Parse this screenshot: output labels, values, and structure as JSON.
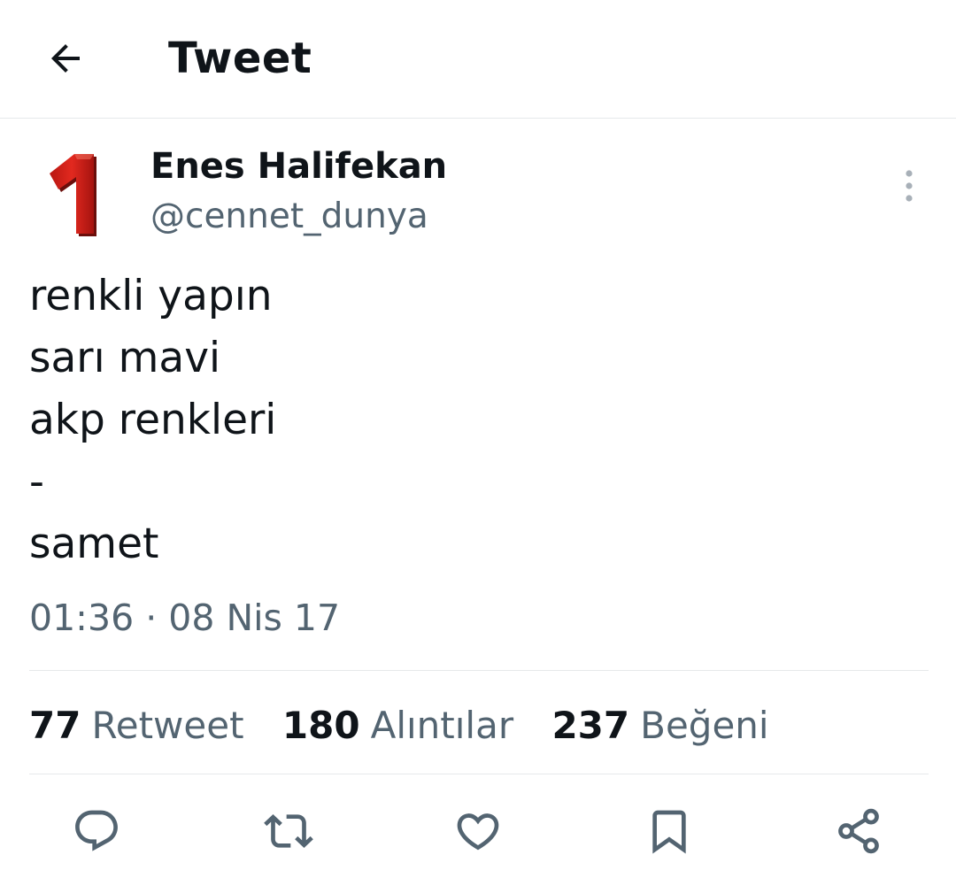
{
  "header": {
    "title": "Tweet",
    "back_icon": "back-arrow-icon"
  },
  "author": {
    "display_name": "Enes Halifekan",
    "handle": "@cennet_dunya",
    "avatar_text": "1",
    "avatar_color": "#d0231f"
  },
  "tweet": {
    "lines": [
      "renkli yapın",
      "sarı mavi",
      "akp renkleri",
      "-",
      "samet"
    ],
    "timestamp": "01:36 · 08 Nis 17"
  },
  "stats": [
    {
      "count": "77",
      "label": "Retweet"
    },
    {
      "count": "180",
      "label": "Alıntılar"
    },
    {
      "count": "237",
      "label": "Beğeni"
    }
  ],
  "actions": [
    "reply-icon",
    "retweet-icon",
    "like-icon",
    "bookmark-icon",
    "share-icon"
  ],
  "colors": {
    "text_primary": "#0f1419",
    "text_secondary": "#536471",
    "divider": "#e6e9ea"
  }
}
